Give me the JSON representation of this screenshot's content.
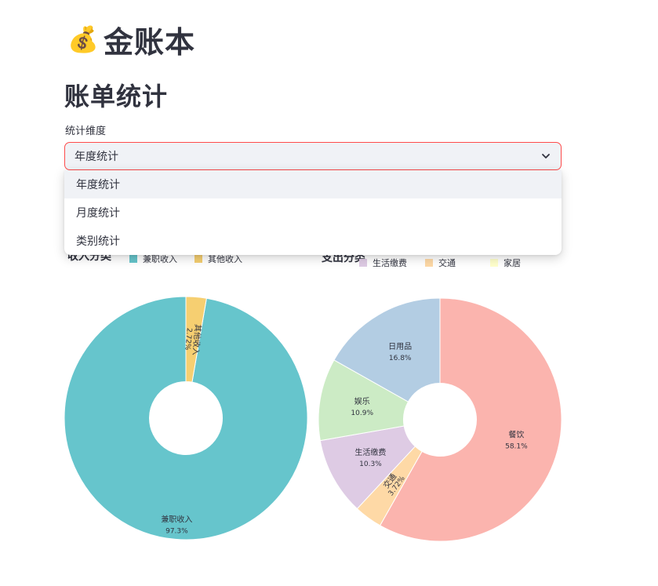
{
  "app": {
    "icon": "money-bag-icon",
    "icon_glyph": "💰",
    "title": "金账本"
  },
  "page": {
    "title": "账单统计"
  },
  "select": {
    "label": "统计维度",
    "value": "年度统计",
    "options": [
      "年度统计",
      "月度统计",
      "类别统计"
    ],
    "accent_color": "#ff4b4b"
  },
  "income_chart": {
    "legend_title": "收入分类",
    "legend_items": [
      {
        "name": "兼职收入",
        "color": "#66c5cc"
      },
      {
        "name": "其他收入",
        "color": "#f6cf71"
      }
    ]
  },
  "expense_chart": {
    "legend_title": "支出分类",
    "legend_items": [
      {
        "name": "生活缴费",
        "color": "#decbe4"
      },
      {
        "name": "交通",
        "color": "#fed9a6"
      },
      {
        "name": "家居",
        "color": "#ffffcc"
      }
    ]
  },
  "chart_data": [
    {
      "type": "pie",
      "hole": 0.3,
      "slices": [
        {
          "label": "兼职收入",
          "value": 97.3,
          "pct_text": "97.3%",
          "color": "#66c5cc"
        },
        {
          "label": "其他收入",
          "value": 2.72,
          "pct_text": "2.72%",
          "color": "#f6cf71"
        }
      ]
    },
    {
      "type": "pie",
      "hole": 0.3,
      "slices": [
        {
          "label": "餐饮",
          "value": 58.1,
          "pct_text": "58.1%",
          "color": "#fbb4ae"
        },
        {
          "label": "交通",
          "value": 3.72,
          "pct_text": "3.72%",
          "color": "#fed9a6"
        },
        {
          "label": "生活缴费",
          "value": 10.3,
          "pct_text": "10.3%",
          "color": "#decbe4"
        },
        {
          "label": "娱乐",
          "value": 10.9,
          "pct_text": "10.9%",
          "color": "#ccebc5"
        },
        {
          "label": "日用品",
          "value": 16.8,
          "pct_text": "16.8%",
          "color": "#b3cde3"
        }
      ]
    }
  ]
}
